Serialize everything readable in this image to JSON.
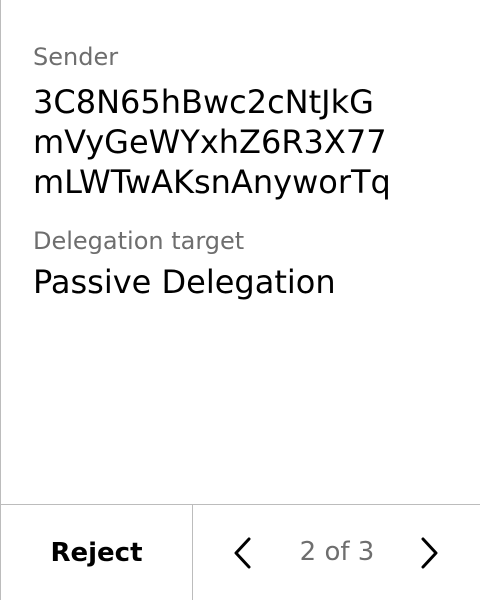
{
  "fields": {
    "sender": {
      "label": "Sender",
      "lines": [
        "3C8N65hBwc2cNtJkG",
        "mVyGeWYxhZ6R3X77",
        "mLWTwAKsnAnyworTq"
      ]
    },
    "delegation_target": {
      "label": "Delegation target",
      "value": "Passive Delegation"
    }
  },
  "footer": {
    "reject_label": "Reject",
    "page_indicator": "2 of 3",
    "prev_icon": "chevron-left-icon",
    "next_icon": "chevron-right-icon"
  },
  "colors": {
    "divider": "#bcbcbc",
    "label_text": "#6e6e6e",
    "value_text": "#000000",
    "background": "#ffffff"
  }
}
